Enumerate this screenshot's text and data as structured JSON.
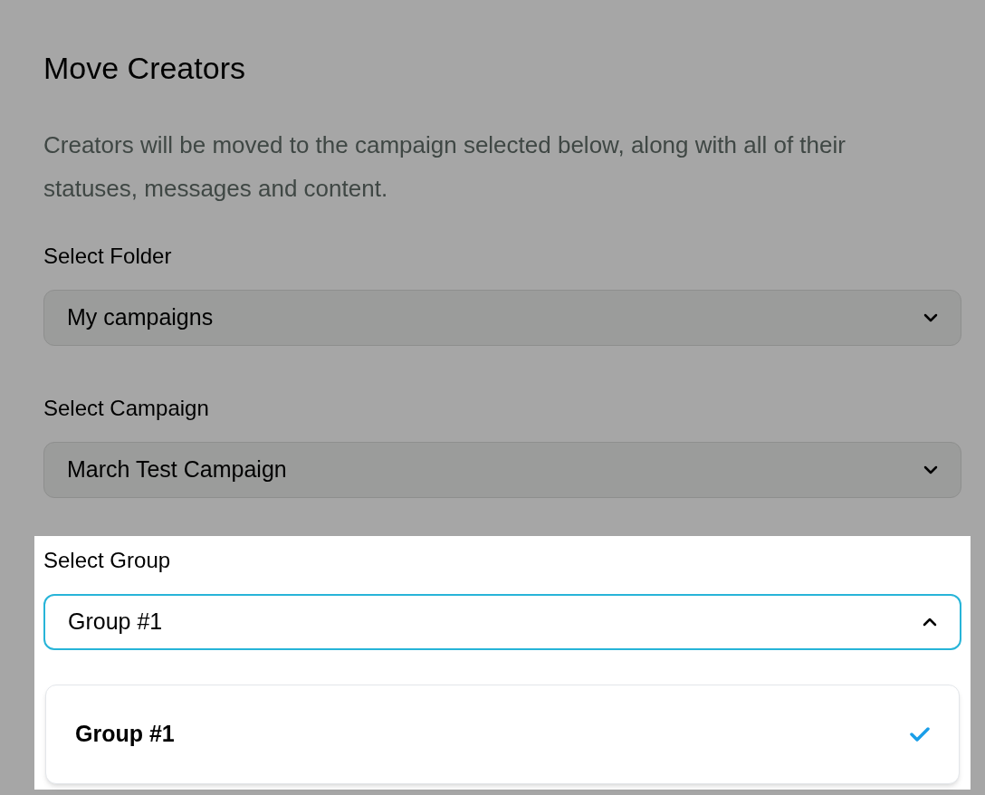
{
  "title": "Move Creators",
  "description": "Creators will be moved to the campaign selected below, along with all of their statuses, messages and content.",
  "fields": [
    {
      "label": "Select Folder",
      "value": "My campaigns",
      "expanded": false,
      "highlighted": false
    },
    {
      "label": "Select Campaign",
      "value": "March Test Campaign",
      "expanded": false,
      "highlighted": false
    },
    {
      "label": "Select Group",
      "value": "Group #1",
      "expanded": true,
      "highlighted": true,
      "options": [
        {
          "label": "Group #1",
          "selected": true
        }
      ]
    }
  ]
}
